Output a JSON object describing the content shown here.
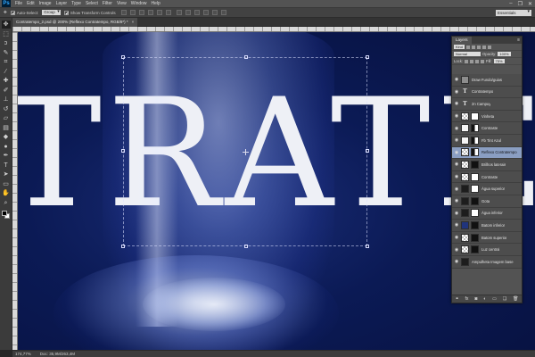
{
  "app": {
    "logo": "Ps"
  },
  "menu": [
    "File",
    "Edit",
    "Image",
    "Layer",
    "Type",
    "Select",
    "Filter",
    "View",
    "Window",
    "Help"
  ],
  "window_controls": [
    "–",
    "❐",
    "✕"
  ],
  "options_bar": {
    "auto_select_label": "Auto-Select:",
    "auto_select_value": "Group",
    "show_transform_label": "Show Transform Controls",
    "workspace": "Essentials"
  },
  "document": {
    "tab_title": "Contratempo_2.psd @ 200% (Reflexo Contratempo, RGB/8*) *",
    "close": "×",
    "canvas_text": "TRATEM"
  },
  "status": {
    "zoom": "174,77%",
    "doc_info": "Doc: 35,9M/263,4M"
  },
  "layers_panel": {
    "title": "Layers",
    "menu_icon": "≡",
    "kind_label": "Kind",
    "blend_mode": "Normal",
    "opacity_label": "Opacity:",
    "opacity_value": "100%",
    "lock_label": "Lock:",
    "fill_label": "Fill:",
    "fill_value": "75%",
    "layers": [
      {
        "name": "Draw Fundo/guias",
        "thumb": "grey",
        "mask": "",
        "selected": false
      },
      {
        "name": "Contratempo",
        "thumb": "text",
        "mask": "",
        "selected": false
      },
      {
        "name": "2n Campuy",
        "thumb": "text",
        "mask": "",
        "selected": false
      },
      {
        "name": "Vinheta",
        "thumb": "checker",
        "mask": "white",
        "selected": false
      },
      {
        "name": "Contraste",
        "thumb": "white",
        "mask": "half",
        "selected": false
      },
      {
        "name": "Fb Tint Azul",
        "thumb": "white",
        "mask": "half",
        "selected": false
      },
      {
        "name": "Reflexo Contratempo",
        "thumb": "checker",
        "mask": "half",
        "selected": true
      },
      {
        "name": "Brilhos laterais",
        "thumb": "checker",
        "mask": "black",
        "selected": false
      },
      {
        "name": "Contraste",
        "thumb": "checker",
        "mask": "white",
        "selected": false
      },
      {
        "name": "Água superior",
        "thumb": "dark",
        "mask": "white",
        "selected": false
      },
      {
        "name": "Gota",
        "thumb": "dark",
        "mask": "black",
        "selected": false
      },
      {
        "name": "Água inferior",
        "thumb": "dark",
        "mask": "white",
        "selected": false
      },
      {
        "name": "Batom inferior",
        "thumb": "blue",
        "mask": "black",
        "selected": false
      },
      {
        "name": "Batom superior",
        "thumb": "checker",
        "mask": "black",
        "selected": false
      },
      {
        "name": "Luz central",
        "thumb": "checker",
        "mask": "black",
        "selected": false
      },
      {
        "name": "Ampulheta Imagem base",
        "thumb": "dark",
        "mask": "",
        "selected": false
      }
    ],
    "footer_icons": [
      "link-icon",
      "fx-icon",
      "mask-icon",
      "adjustment-icon",
      "folder-icon",
      "new-layer-icon",
      "trash-icon"
    ]
  },
  "tools": [
    "move-tool-icon",
    "marquee-tool-icon",
    "lasso-tool-icon",
    "quick-select-tool-icon",
    "crop-tool-icon",
    "eyedropper-tool-icon",
    "healing-brush-tool-icon",
    "brush-tool-icon",
    "clone-stamp-tool-icon",
    "history-brush-tool-icon",
    "eraser-tool-icon",
    "gradient-tool-icon",
    "blur-tool-icon",
    "dodge-tool-icon",
    "pen-tool-icon",
    "type-tool-icon",
    "path-select-tool-icon",
    "shape-tool-icon",
    "hand-tool-icon",
    "zoom-tool-icon"
  ],
  "colors": {
    "accent_selected_layer": "#8a9ec2",
    "canvas_background": "#0b1a55"
  }
}
